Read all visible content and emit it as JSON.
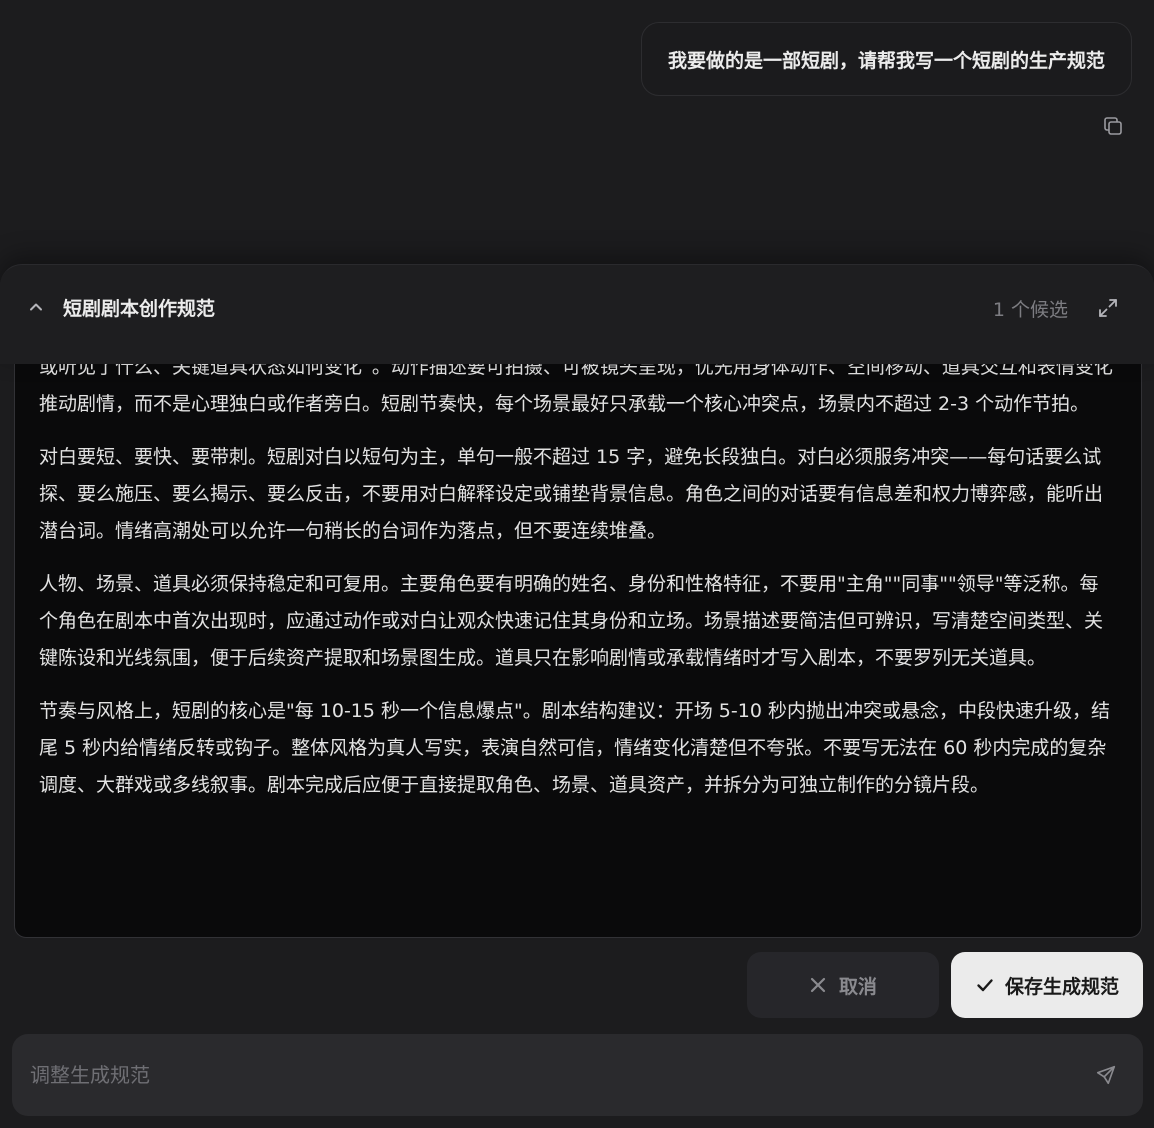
{
  "user_message": {
    "text": "我要做的是一部短剧，请帮我写一个短剧的生产规范",
    "copy_icon": "copy-icon"
  },
  "spec_panel": {
    "title": "短剧剧本创作规范",
    "candidate_count": "1 个候选",
    "collapse_icon": "chevron-up-icon",
    "expand_icon": "expand-icon",
    "paragraphs": [
      "或听见了什么、关键道具状态如何变化”。动作描述要可拍摄、可被镜头呈现，优先用身体动作、空间移动、道具交互和表情变化推动剧情，而不是心理独白或作者旁白。短剧节奏快，每个场景最好只承载一个核心冲突点，场景内不超过 2-3 个动作节拍。",
      "对白要短、要快、要带刺。短剧对白以短句为主，单句一般不超过 15 字，避免长段独白。对白必须服务冲突——每句话要么试探、要么施压、要么揭示、要么反击，不要用对白解释设定或铺垫背景信息。角色之间的对话要有信息差和权力博弈感，能听出潜台词。情绪高潮处可以允许一句稍长的台词作为落点，但不要连续堆叠。",
      "人物、场景、道具必须保持稳定和可复用。主要角色要有明确的姓名、身份和性格特征，不要用\"主角\"\"同事\"\"领导\"等泛称。每个角色在剧本中首次出现时，应通过动作或对白让观众快速记住其身份和立场。场景描述要简洁但可辨识，写清楚空间类型、关键陈设和光线氛围，便于后续资产提取和场景图生成。道具只在影响剧情或承载情绪时才写入剧本，不要罗列无关道具。",
      "节奏与风格上，短剧的核心是\"每 10-15 秒一个信息爆点\"。剧本结构建议：开场 5-10 秒内抛出冲突或悬念，中段快速升级，结尾 5 秒内给情绪反转或钩子。整体风格为真人写实，表演自然可信，情绪变化清楚但不夸张。不要写无法在 60 秒内完成的复杂调度、大群戏或多线叙事。剧本完成后应便于直接提取角色、场景、道具资产，并拆分为可独立制作的分镜片段。"
    ]
  },
  "actions": {
    "cancel_label": "取消",
    "cancel_icon": "close-icon",
    "save_label": "保存生成规范",
    "save_icon": "check-icon"
  },
  "composer": {
    "placeholder": "调整生成规范",
    "value": "",
    "send_icon": "send-icon"
  },
  "colors": {
    "background": "#1c1c1e",
    "content_background": "#0a0a0b",
    "save_button": "#ebebeb",
    "cancel_button": "#26262a",
    "muted_text": "#7d7d82"
  }
}
